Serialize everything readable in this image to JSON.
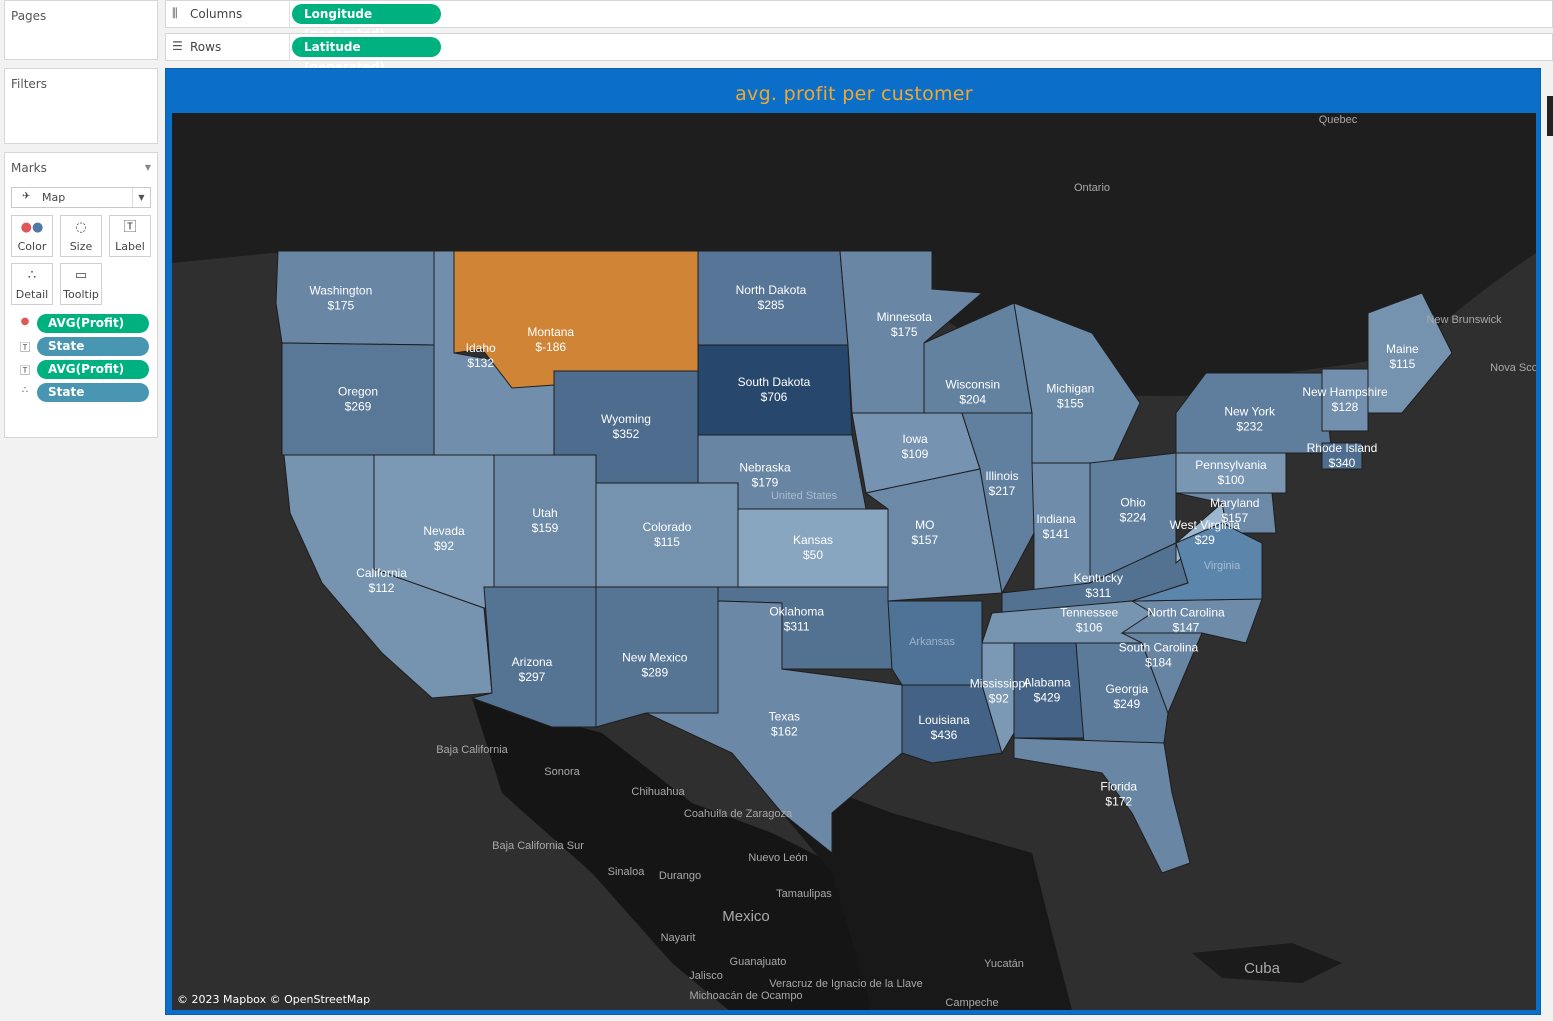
{
  "pages_card": {
    "title": "Pages"
  },
  "filters_card": {
    "title": "Filters"
  },
  "marks_card": {
    "title": "Marks",
    "mark_type": "Map",
    "buttons": {
      "color": "Color",
      "size": "Size",
      "label": "Label",
      "detail": "Detail",
      "tooltip": "Tooltip"
    },
    "pills": [
      {
        "name": "AVG(Profit)",
        "kind": "color"
      },
      {
        "name": "State",
        "kind": "label"
      },
      {
        "name": "AVG(Profit)",
        "kind": "label"
      },
      {
        "name": "State",
        "kind": "detail"
      }
    ]
  },
  "shelves": {
    "columns": {
      "label": "Columns",
      "pill": "Longitude (generated)"
    },
    "rows": {
      "label": "Rows",
      "pill": "Latitude (generated)"
    }
  },
  "viz": {
    "title": "avg. profit per customer",
    "credit": "© 2023 Mapbox © OpenStreetMap",
    "colors": {
      "accent_title": "#f0a830",
      "negative": "#d08536",
      "positive_scale": [
        "#9ab7cf",
        "#27476d"
      ]
    },
    "states": [
      {
        "name": "Washington",
        "value": "$175"
      },
      {
        "name": "Oregon",
        "value": "$269"
      },
      {
        "name": "California",
        "value": "$112"
      },
      {
        "name": "Nevada",
        "value": "$92"
      },
      {
        "name": "Idaho",
        "value": "$132"
      },
      {
        "name": "Montana",
        "value": "$-186"
      },
      {
        "name": "Wyoming",
        "value": "$352"
      },
      {
        "name": "Utah",
        "value": "$159"
      },
      {
        "name": "Arizona",
        "value": "$297"
      },
      {
        "name": "Colorado",
        "value": "$115"
      },
      {
        "name": "New Mexico",
        "value": "$289"
      },
      {
        "name": "North Dakota",
        "value": "$285"
      },
      {
        "name": "South Dakota",
        "value": "$706"
      },
      {
        "name": "Nebraska",
        "value": "$179"
      },
      {
        "name": "Kansas",
        "value": "$50"
      },
      {
        "name": "Oklahoma",
        "value": "$311"
      },
      {
        "name": "Texas",
        "value": "$162"
      },
      {
        "name": "Minnesota",
        "value": "$175"
      },
      {
        "name": "Iowa",
        "value": "$109"
      },
      {
        "name": "MO",
        "value": "$157"
      },
      {
        "name": "Louisiana",
        "value": "$436"
      },
      {
        "name": "Wisconsin",
        "value": "$204"
      },
      {
        "name": "Illinois",
        "value": "$217"
      },
      {
        "name": "Michigan",
        "value": "$155"
      },
      {
        "name": "Indiana",
        "value": "$141"
      },
      {
        "name": "Ohio",
        "value": "$224"
      },
      {
        "name": "Kentucky",
        "value": "$311"
      },
      {
        "name": "Tennessee",
        "value": "$106"
      },
      {
        "name": "Mississippi",
        "value": "$92"
      },
      {
        "name": "Alabama",
        "value": "$429"
      },
      {
        "name": "Georgia",
        "value": "$249"
      },
      {
        "name": "Florida",
        "value": "$172"
      },
      {
        "name": "South Carolina",
        "value": "$184"
      },
      {
        "name": "North Carolina",
        "value": "$147"
      },
      {
        "name": "West Virginia",
        "value": "$29"
      },
      {
        "name": "Maryland",
        "value": "$157"
      },
      {
        "name": "Pennsylvania",
        "value": "$100"
      },
      {
        "name": "New York",
        "value": "$232"
      },
      {
        "name": "Rhode Island",
        "value": "$340"
      },
      {
        "name": "New Hampshire",
        "value": "$128"
      },
      {
        "name": "Maine",
        "value": "$115"
      }
    ],
    "basemap_labels": [
      "Quebec",
      "Ontario",
      "New Brunswick",
      "Nova Sco",
      "United States",
      "Arkansas",
      "Virginia",
      "Baja California",
      "Sonora",
      "Chihuahua",
      "Coahuila de Zaragoza",
      "Baja California Sur",
      "Nuevo León",
      "Sinaloa",
      "Durango",
      "Tamaulipas",
      "Mexico",
      "Nayarit",
      "Jalisco",
      "Guanajuato",
      "Michoacán de Ocampo",
      "Veracruz de Ignacio de la Llave",
      "Yucatán",
      "Campeche",
      "Cuba"
    ]
  }
}
